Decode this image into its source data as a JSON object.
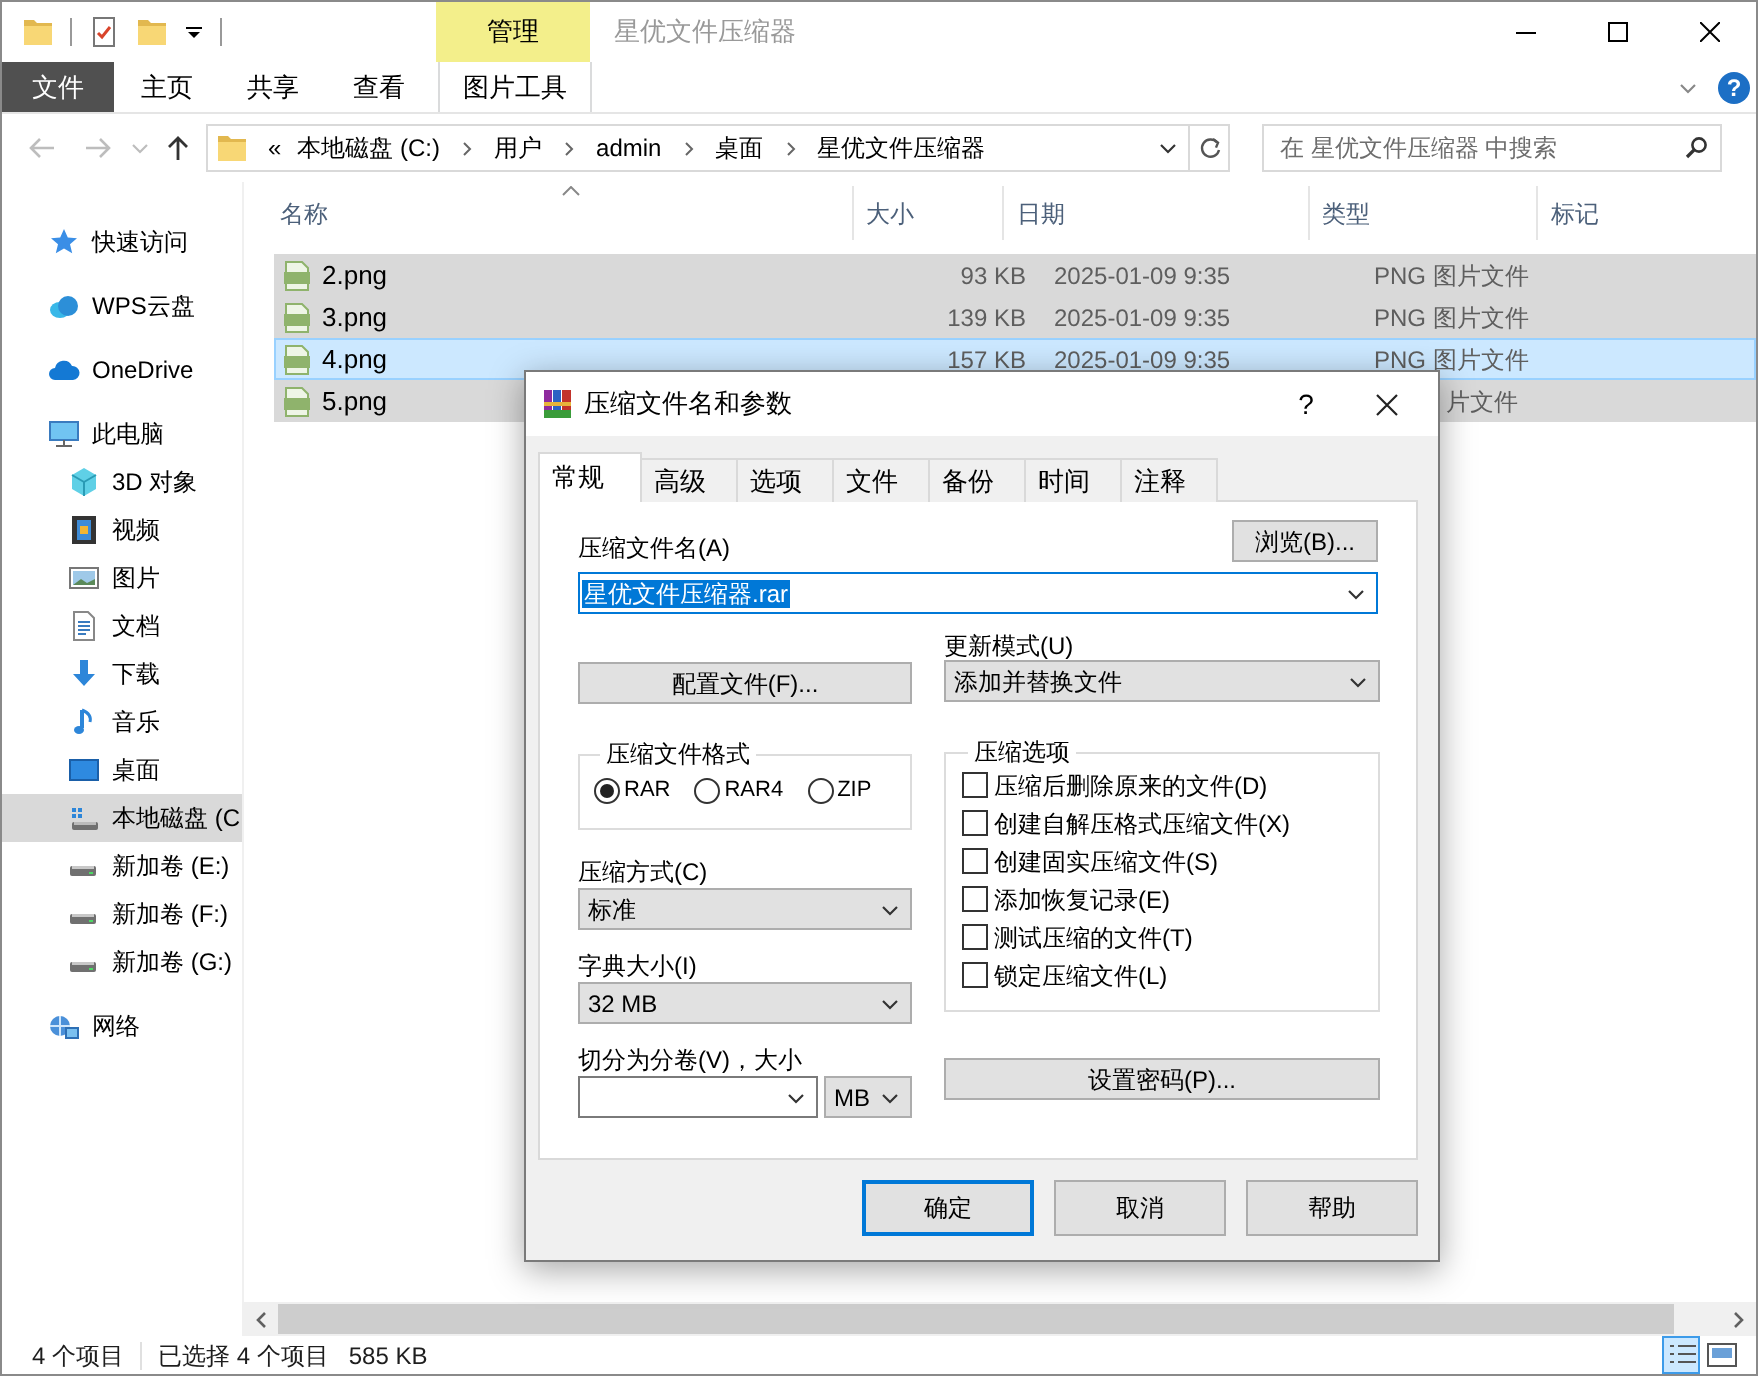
{
  "window": {
    "title": "星优文件压缩器",
    "context_group": "管理"
  },
  "ribbon_tabs": [
    {
      "label": "文件",
      "kind": "file"
    },
    {
      "label": "主页",
      "kind": "tab"
    },
    {
      "label": "共享",
      "kind": "tab"
    },
    {
      "label": "查看",
      "kind": "tab"
    },
    {
      "label": "图片工具",
      "kind": "context"
    }
  ],
  "help_button": "?",
  "navigation": {
    "back_disabled": true,
    "forward_disabled": true
  },
  "address_bar": {
    "overflow": "«",
    "segments": [
      "本地磁盘 (C:)",
      "用户",
      "admin",
      "桌面",
      "星优文件压缩器"
    ]
  },
  "search": {
    "placeholder": "在 星优文件压缩器 中搜索"
  },
  "navigation_pane": [
    {
      "label": "快速访问",
      "kind": "star",
      "selected": false
    },
    {
      "label": "WPS云盘",
      "kind": "wps",
      "selected": false
    },
    {
      "label": "OneDrive",
      "kind": "onedrive",
      "selected": false
    },
    {
      "label": "此电脑",
      "kind": "pc",
      "selected": false,
      "children": [
        {
          "label": "3D 对象",
          "kind": "cube",
          "selected": false
        },
        {
          "label": "视频",
          "kind": "film",
          "selected": false
        },
        {
          "label": "图片",
          "kind": "picture",
          "selected": false
        },
        {
          "label": "文档",
          "kind": "document",
          "selected": false
        },
        {
          "label": "下载",
          "kind": "download",
          "selected": false
        },
        {
          "label": "音乐",
          "kind": "music",
          "selected": false
        },
        {
          "label": "桌面",
          "kind": "desktop",
          "selected": false
        },
        {
          "label": "本地磁盘 (C",
          "kind": "system_drive",
          "selected": true
        },
        {
          "label": "新加卷 (E:)",
          "kind": "drive",
          "selected": false
        },
        {
          "label": "新加卷 (F:)",
          "kind": "drive",
          "selected": false
        },
        {
          "label": "新加卷 (G:)",
          "kind": "drive",
          "selected": false
        }
      ]
    },
    {
      "label": "网络",
      "kind": "network",
      "selected": false
    }
  ],
  "file_list": {
    "columns": [
      {
        "label": "名称",
        "sorted": true
      },
      {
        "label": "大小",
        "sorted": false
      },
      {
        "label": "日期",
        "sorted": false
      },
      {
        "label": "类型",
        "sorted": false
      },
      {
        "label": "标记",
        "sorted": false
      }
    ],
    "rows": [
      {
        "name": "2.png",
        "size": "93 KB",
        "date": "2025-01-09 9:35",
        "type": "PNG 图片文件",
        "selected": true,
        "focused": false
      },
      {
        "name": "3.png",
        "size": "139 KB",
        "date": "2025-01-09 9:35",
        "type": "PNG 图片文件",
        "selected": true,
        "focused": false
      },
      {
        "name": "4.png",
        "size": "157 KB",
        "date": "2025-01-09 9:35",
        "type": "PNG 图片文件",
        "selected": true,
        "focused": true
      },
      {
        "name": "5.png",
        "type": "片文件",
        "clipped": true,
        "selected": true,
        "focused": false
      }
    ]
  },
  "status_bar": {
    "item_count": "4 个项目",
    "selection": "已选择 4 个项目",
    "size": "585 KB",
    "view_modes": [
      {
        "kind": "details",
        "selected": true
      },
      {
        "kind": "large_icons",
        "selected": false
      }
    ]
  },
  "dialog": {
    "title": "压缩文件名和参数",
    "help_button": "?",
    "tabs": [
      {
        "label": "常规",
        "selected": true
      },
      {
        "label": "高级",
        "selected": false
      },
      {
        "label": "选项",
        "selected": false
      },
      {
        "label": "文件",
        "selected": false
      },
      {
        "label": "备份",
        "selected": false
      },
      {
        "label": "时间",
        "selected": false
      },
      {
        "label": "注释",
        "selected": false
      }
    ],
    "archive_name_label": "压缩文件名(A)",
    "browse_button": "浏览(B)...",
    "archive_name": "星优文件压缩器.rar",
    "archive_name_highlighted": true,
    "profiles_button": "配置文件(F)...",
    "update_mode_label": "更新模式(U)",
    "update_mode": "添加并替换文件",
    "format_group": "压缩文件格式",
    "formats": [
      {
        "label": "RAR",
        "selected": true
      },
      {
        "label": "RAR4",
        "selected": false
      },
      {
        "label": "ZIP",
        "selected": false
      }
    ],
    "method_label": "压缩方式(C)",
    "method": "标准",
    "dictionary_label": "字典大小(I)",
    "dictionary": "32 MB",
    "split_label": "切分为分卷(V)，大小",
    "split_unit": "MB",
    "options_group": "压缩选项",
    "options": [
      {
        "label": "压缩后删除原来的文件(D)",
        "checked": false
      },
      {
        "label": "创建自解压格式压缩文件(X)",
        "checked": false
      },
      {
        "label": "创建固实压缩文件(S)",
        "checked": false
      },
      {
        "label": "添加恢复记录(E)",
        "checked": false
      },
      {
        "label": "测试压缩的文件(T)",
        "checked": false
      },
      {
        "label": "锁定压缩文件(L)",
        "checked": false
      }
    ],
    "password_button": "设置密码(P)...",
    "buttons": [
      {
        "label": "确定",
        "default": true
      },
      {
        "label": "取消",
        "default": false
      },
      {
        "label": "帮助",
        "default": false
      }
    ]
  }
}
